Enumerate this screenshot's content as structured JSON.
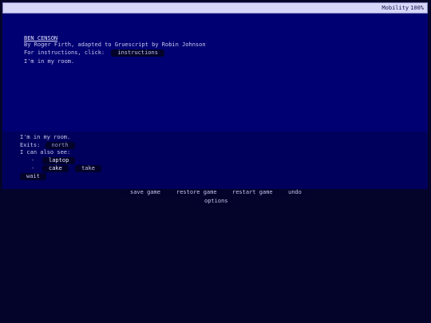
{
  "status": {
    "label": "Mobility",
    "value": "100%"
  },
  "story": {
    "title": "BEN CENSON",
    "byline": "By Roger Firth, adapted to Gruescript by Robin Johnson",
    "instructions_prompt": "For instructions, click:",
    "instructions_button": "instructions",
    "location_text": "I'm in my room."
  },
  "panel": {
    "location": "I'm in my room.",
    "exits_label": "Exits:",
    "exits": [
      "north"
    ],
    "see_label": "I can also see:",
    "items": [
      {
        "bullet": "-",
        "name": "laptop",
        "actions": []
      },
      {
        "bullet": "-",
        "name": "cake",
        "actions": [
          "take"
        ]
      }
    ],
    "wait_button": "wait"
  },
  "buttons": {
    "save": "save game",
    "restore": "restore game",
    "restart": "restart game",
    "undo": "undo",
    "options": "options"
  }
}
